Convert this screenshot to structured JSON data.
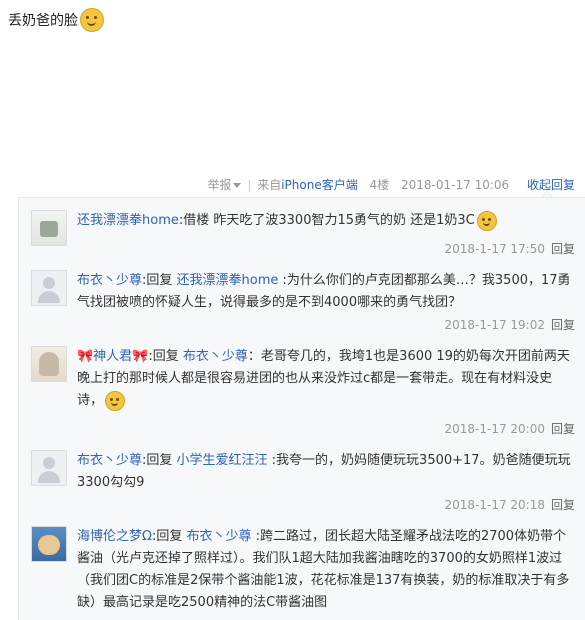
{
  "post": {
    "text": "丢奶爸的脸"
  },
  "tail": {
    "report": "举报",
    "source": "来自",
    "device": "iPhone客户端",
    "floor": "4楼",
    "time": "2018-01-17 10:06",
    "collapse": "收起回复"
  },
  "replies": [
    {
      "user": "还我漂漂拳home",
      "colon": ":",
      "text": "借楼 昨天吃了波3300智力15勇气的奶 还是1奶3C",
      "time": "2018-1-17 17:50",
      "reply": "回复"
    },
    {
      "user": "布衣丶少尊",
      "prefix": ":回复 ",
      "target": "还我漂漂拳home",
      "text": " :为什么你们的卢克团都那么美…？我3500，17勇气找团被喷的怀疑人生，说得最多的是不到4000哪来的勇气找团？",
      "time": "2018-1-17 19:02",
      "reply": "回复"
    },
    {
      "user": "🎀神人君🎀",
      "prefix": ":回复 ",
      "target": "布衣丶少尊",
      "text": "：老哥夸几的，我垮1也是3600 19的奶每次开团前两天晚上打的那时候人都是很容易进团的也从来没炸过c都是一套带走。现在有材料没史诗，",
      "time": "2018-1-17 20:00",
      "reply": "回复"
    },
    {
      "user": "布衣丶少尊",
      "prefix": ":回复 ",
      "target": "小学生爱红汪汪",
      "text": " :我夸一的，奶妈随便玩玩3500+17。奶爸随便玩玩3300勾勾9",
      "time": "2018-1-17 20:18",
      "reply": "回复"
    },
    {
      "user": "海博伦之梦Ω",
      "prefix": ":回复 ",
      "target": "布衣丶少尊",
      "text": " :跨二路过，团长超大陆圣耀矛战法吃的2700体奶带个酱油（光卢克还掉了照样过）。我们队1超大陆加我酱油瞎吃的3700的女奶照样1波过（我们团C的标准是2保带个酱油能1波，花花标准是137有换装，奶的标准取决于有多缺）最高记录是吃2500精神的法C带酱油图"
    }
  ]
}
